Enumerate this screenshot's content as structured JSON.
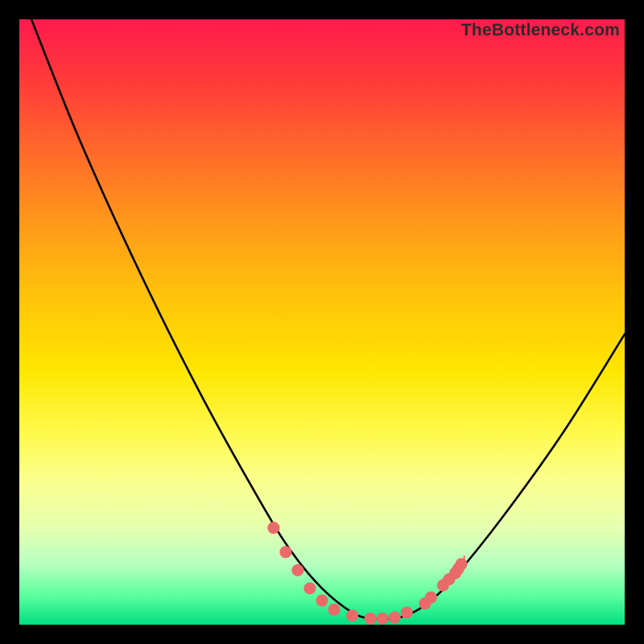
{
  "watermark": "TheBottleneck.com",
  "chart_data": {
    "type": "line",
    "title": "",
    "xlabel": "",
    "ylabel": "",
    "xlim": [
      0,
      100
    ],
    "ylim": [
      0,
      100
    ],
    "grid": false,
    "series": [
      {
        "name": "bottleneck-curve",
        "x": [
          2,
          10,
          20,
          30,
          40,
          45,
          50,
          55,
          58,
          60,
          62,
          65,
          68,
          72,
          80,
          90,
          100
        ],
        "y": [
          100,
          80,
          58,
          38,
          20,
          12,
          6,
          2,
          1,
          1,
          1,
          2,
          4,
          8,
          18,
          32,
          48
        ]
      }
    ],
    "markers": {
      "name": "highlighted-points",
      "color": "#ea6a6a",
      "x": [
        42,
        44,
        46,
        48,
        50,
        52,
        55,
        58,
        60,
        62,
        64,
        67,
        68,
        70,
        71,
        72,
        72.5,
        73
      ],
      "y": [
        16,
        12,
        9,
        6,
        4,
        2.5,
        1.5,
        1,
        1,
        1.2,
        2,
        3.5,
        4.5,
        6.5,
        7.5,
        8.5,
        9.2,
        10
      ]
    },
    "background_gradient": {
      "stops": [
        {
          "pos": 0,
          "color": "#ff1a4d"
        },
        {
          "pos": 0.5,
          "color": "#ffe600"
        },
        {
          "pos": 1,
          "color": "#00e080"
        }
      ]
    }
  }
}
